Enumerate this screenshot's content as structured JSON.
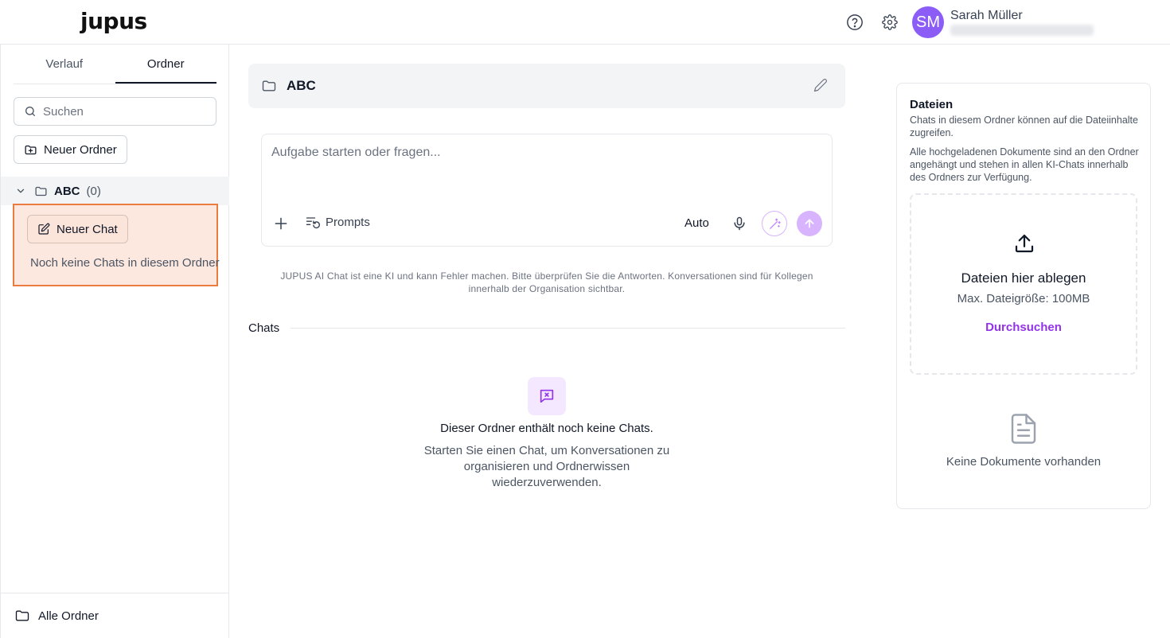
{
  "header": {
    "logo": "jupus",
    "user": {
      "initials": "SM",
      "name": "Sarah Müller",
      "avatar_color": "#8b5cf6"
    }
  },
  "sidebar": {
    "tabs": [
      {
        "label": "Verlauf"
      },
      {
        "label": "Ordner",
        "active": true
      }
    ],
    "search": {
      "placeholder": "Suchen",
      "value": ""
    },
    "new_folder_label": "Neuer Ordner",
    "folders": [
      {
        "name": "ABC",
        "count": "(0)",
        "expanded": true,
        "new_chat_label": "Neuer Chat",
        "empty_text": "Noch keine Chats in diesem Ordner"
      }
    ],
    "footer_label": "Alle Ordner"
  },
  "main": {
    "folder_title": "ABC",
    "composer": {
      "placeholder": "Aufgabe starten oder fragen...",
      "prompts_label": "Prompts",
      "mode_label": "Auto"
    },
    "disclaimer": "JUPUS AI Chat ist eine KI und kann Fehler machen. Bitte überprüfen Sie die Antworten. Konversationen sind für Kollegen innerhalb der Organisation sichtbar.",
    "chats_section_label": "Chats",
    "empty_title": "Dieser Ordner enthält noch keine Chats.",
    "empty_text": "Starten Sie einen Chat, um Konversationen zu organisieren und Ordnerwissen wiederzuverwenden."
  },
  "files": {
    "title": "Dateien",
    "desc1": "Chats in diesem Ordner können auf die Dateiinhalte zugreifen.",
    "desc2": "Alle hochgeladenen Dokumente sind an den Ordner angehängt und stehen in allen KI-Chats innerhalb des Ordners zur Verfügung.",
    "dropzone": {
      "title": "Dateien hier ablegen",
      "max_size": "Max. Dateigröße: 100MB",
      "browse_label": "Durchsuchen"
    },
    "empty_text": "Keine Dokumente vorhanden"
  },
  "colors": {
    "accent": "#9333ea",
    "highlight_border": "#ea7c3f",
    "highlight_bg": "#fde8df"
  }
}
